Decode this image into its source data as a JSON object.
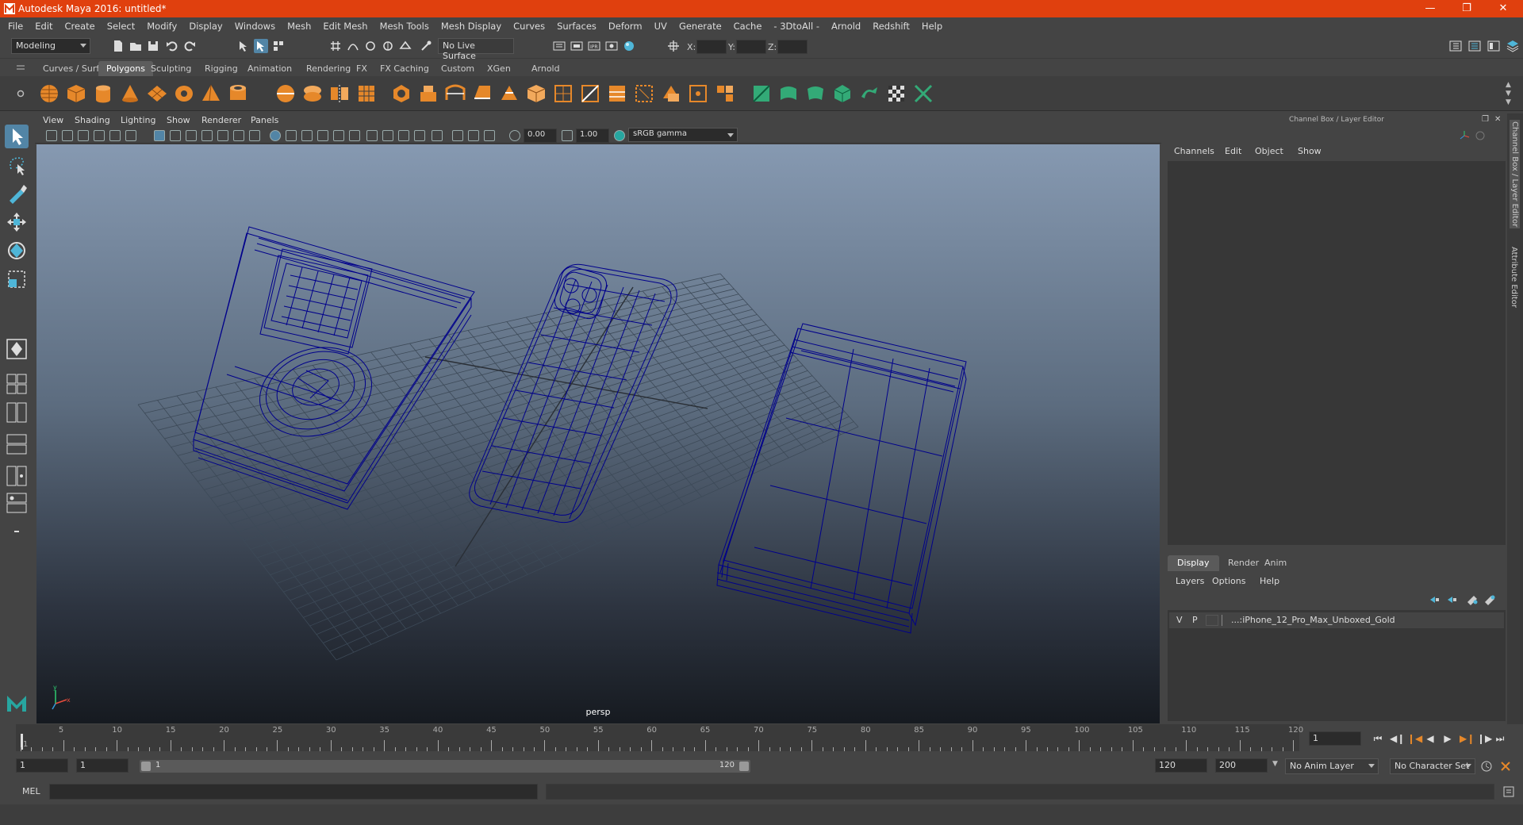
{
  "app": {
    "title": "Autodesk Maya 2016: untitled*",
    "accent_color": "#e0400e"
  },
  "window_controls": [
    "minimize-icon",
    "restore-icon",
    "close-icon"
  ],
  "menubar": [
    "File",
    "Edit",
    "Create",
    "Select",
    "Modify",
    "Display",
    "Windows",
    "Mesh",
    "Edit Mesh",
    "Mesh Tools",
    "Mesh Display",
    "Curves",
    "Surfaces",
    "Deform",
    "UV",
    "Generate",
    "Cache",
    "- 3DtoAll -",
    "Arnold",
    "Redshift",
    "Help"
  ],
  "statusline": {
    "mode": "Modeling",
    "live_surface": "No Live Surface",
    "x_label": "X:",
    "y_label": "Y:",
    "z_label": "Z:"
  },
  "shelf": {
    "tabs": [
      "Curves / Surfaces",
      "Polygons",
      "Sculpting",
      "Rigging",
      "Animation",
      "Rendering",
      "FX",
      "FX Caching",
      "Custom",
      "XGen",
      "Arnold"
    ],
    "active_tab": "Polygons"
  },
  "viewport": {
    "menu": [
      "View",
      "Shading",
      "Lighting",
      "Show",
      "Renderer",
      "Panels"
    ],
    "exposure": "0.00",
    "gamma": "1.00",
    "color_space": "sRGB gamma",
    "camera_label": "persp",
    "wire_color": "#00008b"
  },
  "channel_box": {
    "header": "Channel Box / Layer Editor",
    "menu": [
      "Channels",
      "Edit",
      "Object",
      "Show"
    ]
  },
  "layer_editor": {
    "tabs": [
      "Display",
      "Render",
      "Anim"
    ],
    "active_tab": "Display",
    "menu": [
      "Layers",
      "Options",
      "Help"
    ],
    "layer": {
      "v": "V",
      "p": "P",
      "name": "...:iPhone_12_Pro_Max_Unboxed_Gold"
    }
  },
  "side_tabs": [
    "Channel Box / Layer Editor",
    "Attribute Editor"
  ],
  "timeline": {
    "ticks": [
      5,
      10,
      15,
      20,
      25,
      30,
      35,
      40,
      45,
      50,
      55,
      60,
      65,
      70,
      75,
      80,
      85,
      90,
      95,
      100,
      105,
      110,
      115,
      120
    ],
    "start": 1,
    "end": 120,
    "current_frame": "1"
  },
  "range": {
    "start_time": "1",
    "playback_start": "1",
    "slider_start": "1",
    "slider_end": "120",
    "playback_end": "120",
    "end_time": "200",
    "anim_layer": "No Anim Layer",
    "character_set": "No Character Set"
  },
  "command_line": {
    "label": "MEL"
  }
}
